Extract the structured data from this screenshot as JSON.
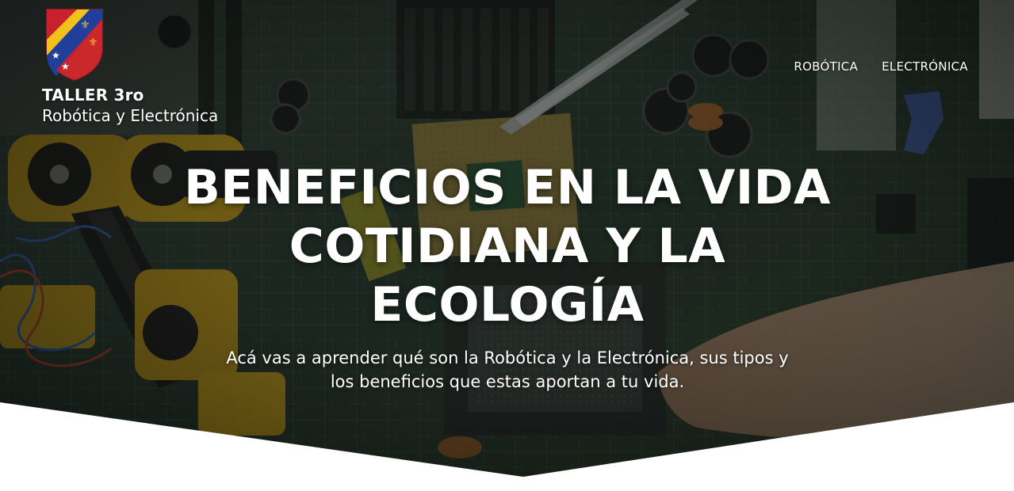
{
  "brand": {
    "title": "TALLER 3ro",
    "subtitle": "Robótica y Electrónica",
    "crest_icon": "school-crest-icon"
  },
  "nav": {
    "items": [
      {
        "label": "ROBÓTICA"
      },
      {
        "label": "ELECTRÓNICA"
      }
    ]
  },
  "hero": {
    "headline_lines": [
      "BENEFICIOS EN LA VIDA",
      "COTIDIANA Y LA",
      "ECOLOGÍA"
    ],
    "description_lines": [
      "Acá vas a aprender qué son la Robótica y la Electrónica, sus tipos y",
      "los beneficios que estas aportan a tu vida."
    ],
    "background_description_icon": "circuit-board-robot-arm-photo"
  },
  "colors": {
    "text": "#ffffff",
    "overlay": "#1a221c",
    "board_green": "#2f4a34",
    "robot_yellow": "#e0b21a",
    "page_bg": "#ffffff",
    "crest_blue": "#1f3f9a",
    "crest_yellow": "#f2c21a",
    "crest_red": "#c8202c"
  }
}
